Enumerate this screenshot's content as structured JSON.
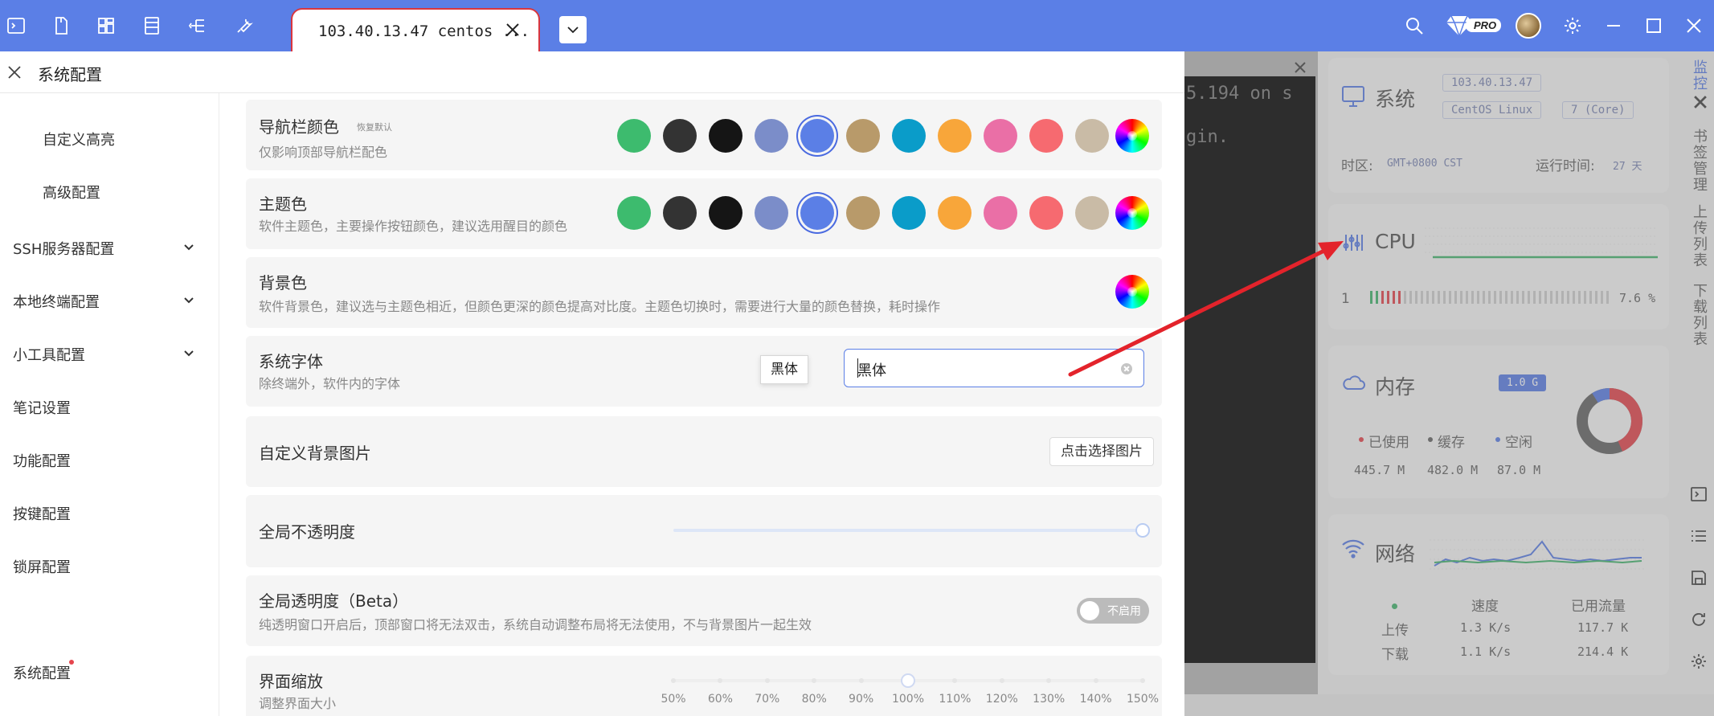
{
  "app": {
    "tab_label": "103.40.13.47 centos ...",
    "pro_label": "PRO",
    "colors": {
      "topbar": "#5b7fe6",
      "accent": "#4a6ae0",
      "arrow": "#e3232b"
    }
  },
  "toolbar_icons": [
    "terminal-icon",
    "file-icon",
    "layout-icon",
    "list-icon",
    "tree-icon",
    "wrench-icon"
  ],
  "settings": {
    "title": "系统配置",
    "nav": [
      {
        "label": "自定义高亮",
        "sub": true
      },
      {
        "label": "高级配置",
        "sub": true
      },
      {
        "label": "SSH服务器配置",
        "expandable": true
      },
      {
        "label": "本地终端配置",
        "expandable": true
      },
      {
        "label": "小工具配置",
        "expandable": true
      },
      {
        "label": "笔记设置"
      },
      {
        "label": "功能配置"
      },
      {
        "label": "按键配置"
      },
      {
        "label": "锁屏配置"
      },
      {
        "label": "系统配置"
      }
    ],
    "rows": {
      "navbar_color": {
        "title": "导航栏颜色",
        "restore": "恢复默认",
        "desc": "仅影响顶部导航栏配色"
      },
      "theme_color": {
        "title": "主题色",
        "desc": "软件主题色，主要操作按钮颜色，建议选用醒目的颜色"
      },
      "bg_color": {
        "title": "背景色",
        "desc": "软件背景色，建议选与主题色相近，但颜色更深的颜色提高对比度。主题色切换时，需要进行大量的颜色替换，耗时操作"
      },
      "system_font": {
        "title": "系统字体",
        "desc": "除终端外，软件内的字体",
        "value": "黑体",
        "tooltip": "黑体"
      },
      "bg_image": {
        "title": "自定义背景图片",
        "button": "点击选择图片"
      },
      "opacity": {
        "title": "全局不透明度",
        "value": 1.0
      },
      "transparency": {
        "title": "全局透明度（Beta）",
        "desc": "纯透明窗口开启后，顶部窗口将无法双击，系统自动调整布局将无法使用，不与背景图片一起生效",
        "toggle": "不启用"
      },
      "zoom": {
        "title": "界面缩放",
        "desc": "调整界面大小",
        "ticks": [
          "50%",
          "60%",
          "70%",
          "80%",
          "90%",
          "100%",
          "110%",
          "120%",
          "130%",
          "140%",
          "150%"
        ],
        "value": "100%"
      }
    },
    "swatches": [
      "#3dbb6e",
      "#333333",
      "#151515",
      "#7b8dc9",
      "#5b7fe6",
      "#b89a6a",
      "#0a9cc9",
      "#f8a63a",
      "#ea6fa6",
      "#f66a70",
      "#c9bba6"
    ],
    "selected_swatch": 4
  },
  "terminal": {
    "line1": "5.194 on s",
    "line2": "gin."
  },
  "monitor": {
    "system": {
      "title": "系统",
      "ip": "103.40.13.47",
      "os": "CentOS Linux",
      "cores": "7 (Core)",
      "tz_label": "时区:",
      "tz": "GMT+0800  CST",
      "uptime_label": "运行时间:",
      "uptime": "27 天"
    },
    "cpu": {
      "title": "CPU",
      "core": "1",
      "usage": "7.6 %"
    },
    "memory": {
      "title": "内存",
      "total": "1.0 G",
      "used_label": "已使用",
      "used": "445.7 M",
      "cache_label": "缓存",
      "cache": "482.0 M",
      "free_label": "空闲",
      "free": "87.0 M"
    },
    "network": {
      "title": "网络",
      "speed_label": "速度",
      "traffic_label": "已用流量",
      "up_label": "上传",
      "up_speed": "1.3 K/s",
      "up_total": "117.7 K",
      "down_label": "下载",
      "down_speed": "1.1 K/s",
      "down_total": "214.4 K"
    }
  },
  "vsidebar": {
    "monitor": "监控",
    "bookmarks": "书签管理",
    "uploads": "上传列表",
    "downloads": "下载列表"
  }
}
